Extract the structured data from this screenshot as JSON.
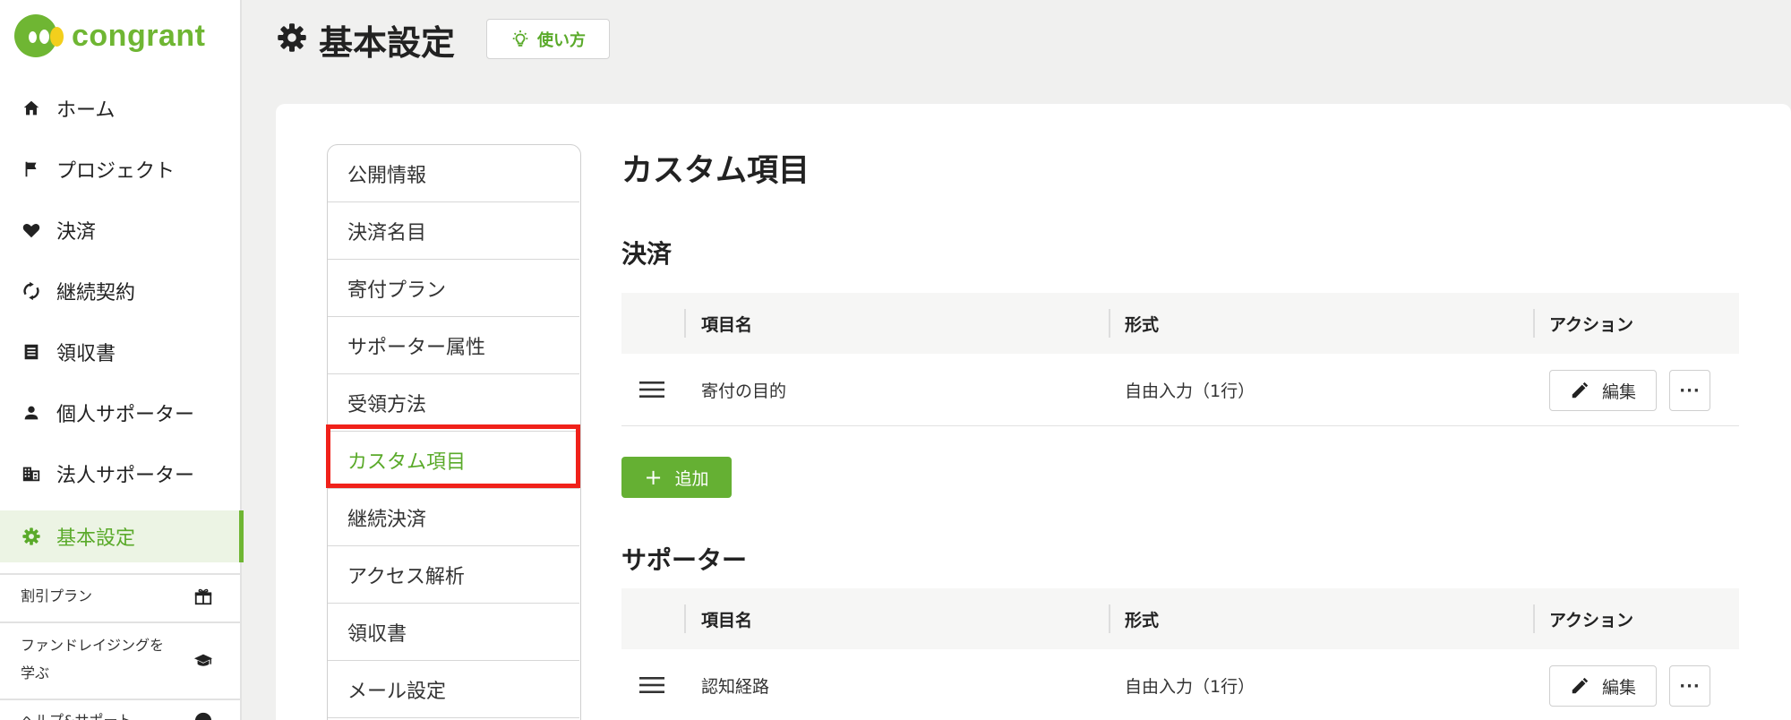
{
  "app": {
    "logo_text": "congrant"
  },
  "sidebar": {
    "items": [
      {
        "label": "ホーム",
        "icon": "home-icon"
      },
      {
        "label": "プロジェクト",
        "icon": "flag-icon"
      },
      {
        "label": "決済",
        "icon": "heart-icon"
      },
      {
        "label": "継続契約",
        "icon": "sync-icon"
      },
      {
        "label": "領収書",
        "icon": "receipt-icon"
      },
      {
        "label": "個人サポーター",
        "icon": "person-icon"
      },
      {
        "label": "法人サポーター",
        "icon": "building-icon"
      },
      {
        "label": "基本設定",
        "icon": "gear-icon",
        "active": true
      }
    ],
    "discount_plan": {
      "label": "割引プラン",
      "icon": "gift-icon"
    },
    "learn_fundraising": {
      "label_line1": "ファンドレイジングを",
      "label_line2": "学ぶ",
      "icon": "graduation-cap-icon"
    },
    "help_support": {
      "label": "ヘルプ&サポート",
      "icon": "help-icon"
    }
  },
  "header": {
    "title": "基本設定",
    "howto_label": "使い方"
  },
  "settings_menu": {
    "items": [
      "公開情報",
      "決済名目",
      "寄付プラン",
      "サポーター属性",
      "受領方法",
      "カスタム項目",
      "継続決済",
      "アクセス解析",
      "領収書",
      "メール設定"
    ],
    "current": "カスタム項目"
  },
  "content": {
    "title": "カスタム項目",
    "columns": {
      "name": "項目名",
      "format": "形式",
      "action": "アクション"
    },
    "edit_label": "編集",
    "more_label": "···",
    "sections": [
      {
        "title": "決済",
        "rows": [
          {
            "name": "寄付の目的",
            "format": "自由入力（1行）"
          }
        ],
        "add_label": "追加"
      },
      {
        "title": "サポーター",
        "rows": [
          {
            "name": "認知経路",
            "format": "自由入力（1行）"
          }
        ]
      }
    ]
  },
  "colors": {
    "brand_green": "#6fb633",
    "highlight_red": "#f0211a"
  }
}
